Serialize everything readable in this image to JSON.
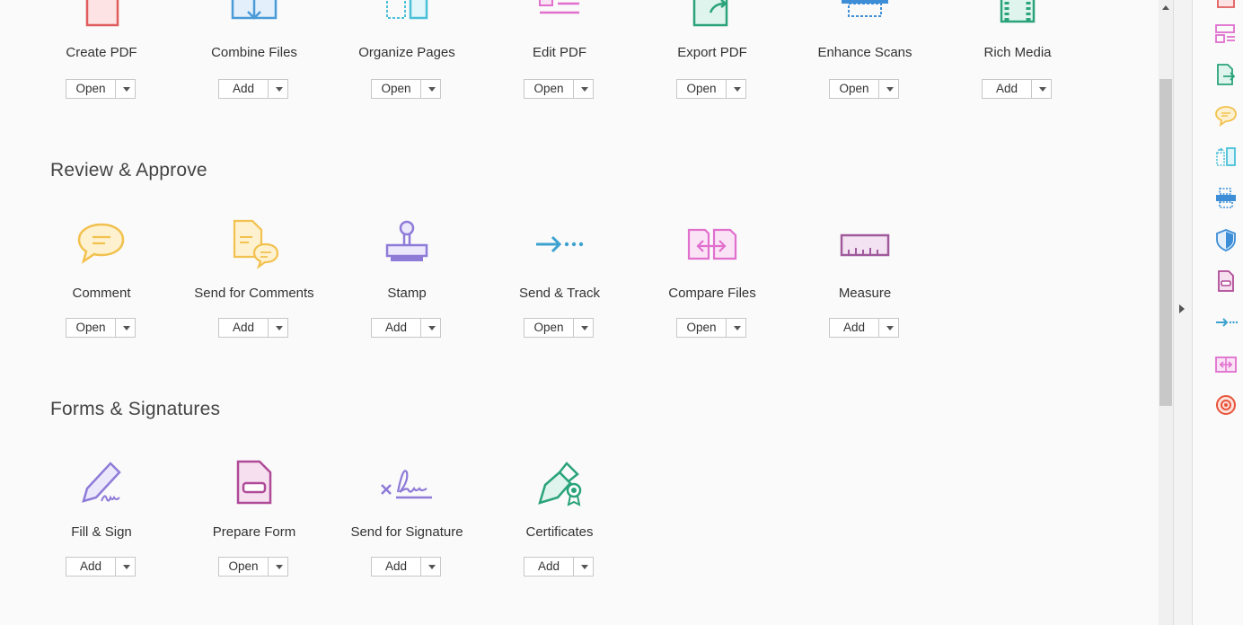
{
  "sections": [
    {
      "title": ""
    },
    {
      "title": "Review & Approve"
    },
    {
      "title": "Forms & Signatures"
    }
  ],
  "tools": [
    {
      "name": "Create PDF",
      "action": "Open",
      "icon": "create-pdf-icon",
      "color": "#e05d5d"
    },
    {
      "name": "Combine Files",
      "action": "Add",
      "icon": "combine-files-icon",
      "color": "#4a9ad8"
    },
    {
      "name": "Organize Pages",
      "action": "Open",
      "icon": "organize-pages-icon",
      "color": "#49c0d8"
    },
    {
      "name": "Edit PDF",
      "action": "Open",
      "icon": "edit-pdf-icon",
      "color": "#e06fce"
    },
    {
      "name": "Export PDF",
      "action": "Open",
      "icon": "export-pdf-icon",
      "color": "#2aa37a"
    },
    {
      "name": "Enhance Scans",
      "action": "Open",
      "icon": "enhance-scans-icon",
      "color": "#3d8ed6"
    },
    {
      "name": "Rich Media",
      "action": "Add",
      "icon": "rich-media-icon",
      "color": "#2aa37a"
    },
    {
      "name": "Comment",
      "action": "Open",
      "icon": "comment-icon",
      "color": "#f2c14e"
    },
    {
      "name": "Send for Comments",
      "action": "Add",
      "icon": "send-for-comments-icon",
      "color": "#f2c14e"
    },
    {
      "name": "Stamp",
      "action": "Add",
      "icon": "stamp-icon",
      "color": "#8e7bd8"
    },
    {
      "name": "Send & Track",
      "action": "Open",
      "icon": "send-track-icon",
      "color": "#3da2d0"
    },
    {
      "name": "Compare Files",
      "action": "Open",
      "icon": "compare-files-icon",
      "color": "#e06fce"
    },
    {
      "name": "Measure",
      "action": "Add",
      "icon": "measure-icon",
      "color": "#a05a9c"
    },
    {
      "name": "Fill & Sign",
      "action": "Add",
      "icon": "fill-sign-icon",
      "color": "#8e7bd8"
    },
    {
      "name": "Prepare Form",
      "action": "Open",
      "icon": "prepare-form-icon",
      "color": "#b04a98"
    },
    {
      "name": "Send for Signature",
      "action": "Add",
      "icon": "send-for-signature-icon",
      "color": "#8e7bd8"
    },
    {
      "name": "Certificates",
      "action": "Add",
      "icon": "certificates-icon",
      "color": "#2aa37a"
    }
  ],
  "right_toolbar": [
    {
      "icon": "create-pdf-icon",
      "color": "#e05d5d"
    },
    {
      "icon": "edit-pdf-icon",
      "color": "#e06fce"
    },
    {
      "icon": "export-pdf-icon",
      "color": "#2aa37a"
    },
    {
      "icon": "comment-icon",
      "color": "#f2c14e"
    },
    {
      "icon": "organize-pages-icon",
      "color": "#49c0d8"
    },
    {
      "icon": "enhance-scans-icon",
      "color": "#3d8ed6"
    },
    {
      "icon": "protect-icon",
      "color": "#3d8ed6"
    },
    {
      "icon": "prepare-form-icon",
      "color": "#b04a98"
    },
    {
      "icon": "send-track-icon",
      "color": "#3da2d0"
    },
    {
      "icon": "compare-files-icon",
      "color": "#e06fce"
    },
    {
      "icon": "optimize-pdf-icon",
      "color": "#e8543a"
    }
  ]
}
